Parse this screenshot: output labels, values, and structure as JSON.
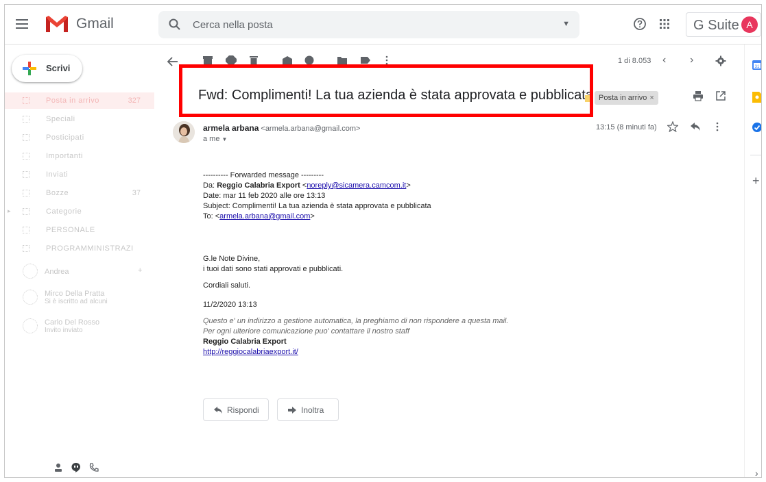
{
  "header": {
    "app_name": "Gmail",
    "search_placeholder": "Cerca nella posta",
    "gsuite_label": "G Suite",
    "avatar_letter": "A"
  },
  "sidebar": {
    "compose_label": "Scrivi",
    "items": [
      {
        "label": "Posta in arrivo",
        "count": "327",
        "active": true
      },
      {
        "label": "Speciali",
        "count": ""
      },
      {
        "label": "Posticipati",
        "count": ""
      },
      {
        "label": "Importanti",
        "count": ""
      },
      {
        "label": "Inviati",
        "count": ""
      },
      {
        "label": "Bozze",
        "count": "37"
      },
      {
        "label": "Categorie",
        "count": ""
      },
      {
        "label": "PERSONALE",
        "count": ""
      },
      {
        "label": "PROGRAMMINISTRAZI",
        "count": ""
      }
    ],
    "hangouts": {
      "me_label": "Andrea",
      "contacts": [
        {
          "name": "Mirco Della Pratta",
          "sub": "Si è iscritto ad alcuni"
        },
        {
          "name": "Carlo Del Rosso",
          "sub": "Invito inviato"
        }
      ]
    }
  },
  "toolbar": {
    "pager_text": "1 di 8.053",
    "prev": "‹",
    "next": "›"
  },
  "message": {
    "subject": "Fwd: Complimenti! La tua azienda è stata approvata e pubblicata",
    "label_chip": "Posta in arrivo",
    "label_remove": "×",
    "sender_name": "armela arbana",
    "sender_email": "<armela.arbana@gmail.com>",
    "to_me": "a me",
    "time": "13:15 (8 minuti fa)",
    "body": {
      "forward_header": "---------- Forwarded message ---------",
      "from_prefix": "Da: ",
      "from_name": "Reggio Calabria Export",
      "from_email": "noreply@sicamera.camcom.it",
      "date_line": "Date: mar 11 feb 2020 alle ore 13:13",
      "subject_line": "Subject: Complimenti! La tua azienda è stata approvata e pubblicata",
      "to_prefix": "To: ",
      "to_email": "armela.arbana@gmail.com",
      "greeting": "G.le Note Divine,",
      "text1": "i tuoi dati sono stati approvati e pubblicati.",
      "closing": "Cordiali saluti.",
      "date_sig": "11/2/2020 13:13",
      "auto_note1": "Questo e' un indirizzo a gestione automatica, la preghiamo di non rispondere a questa mail.",
      "auto_note2": "Per ogni ulteriore comunicazione puo' contattare il nostro staff",
      "sig_name": "Reggio Calabria Export",
      "sig_link": "http://reggiocalabriaexport.it/"
    },
    "reply_label": "Rispondi",
    "forward_label": "Inoltra"
  },
  "colors": {
    "highlight": "#ff0000",
    "gsuite_avatar": "#e8365d",
    "label_marker": "#f8d36a"
  }
}
